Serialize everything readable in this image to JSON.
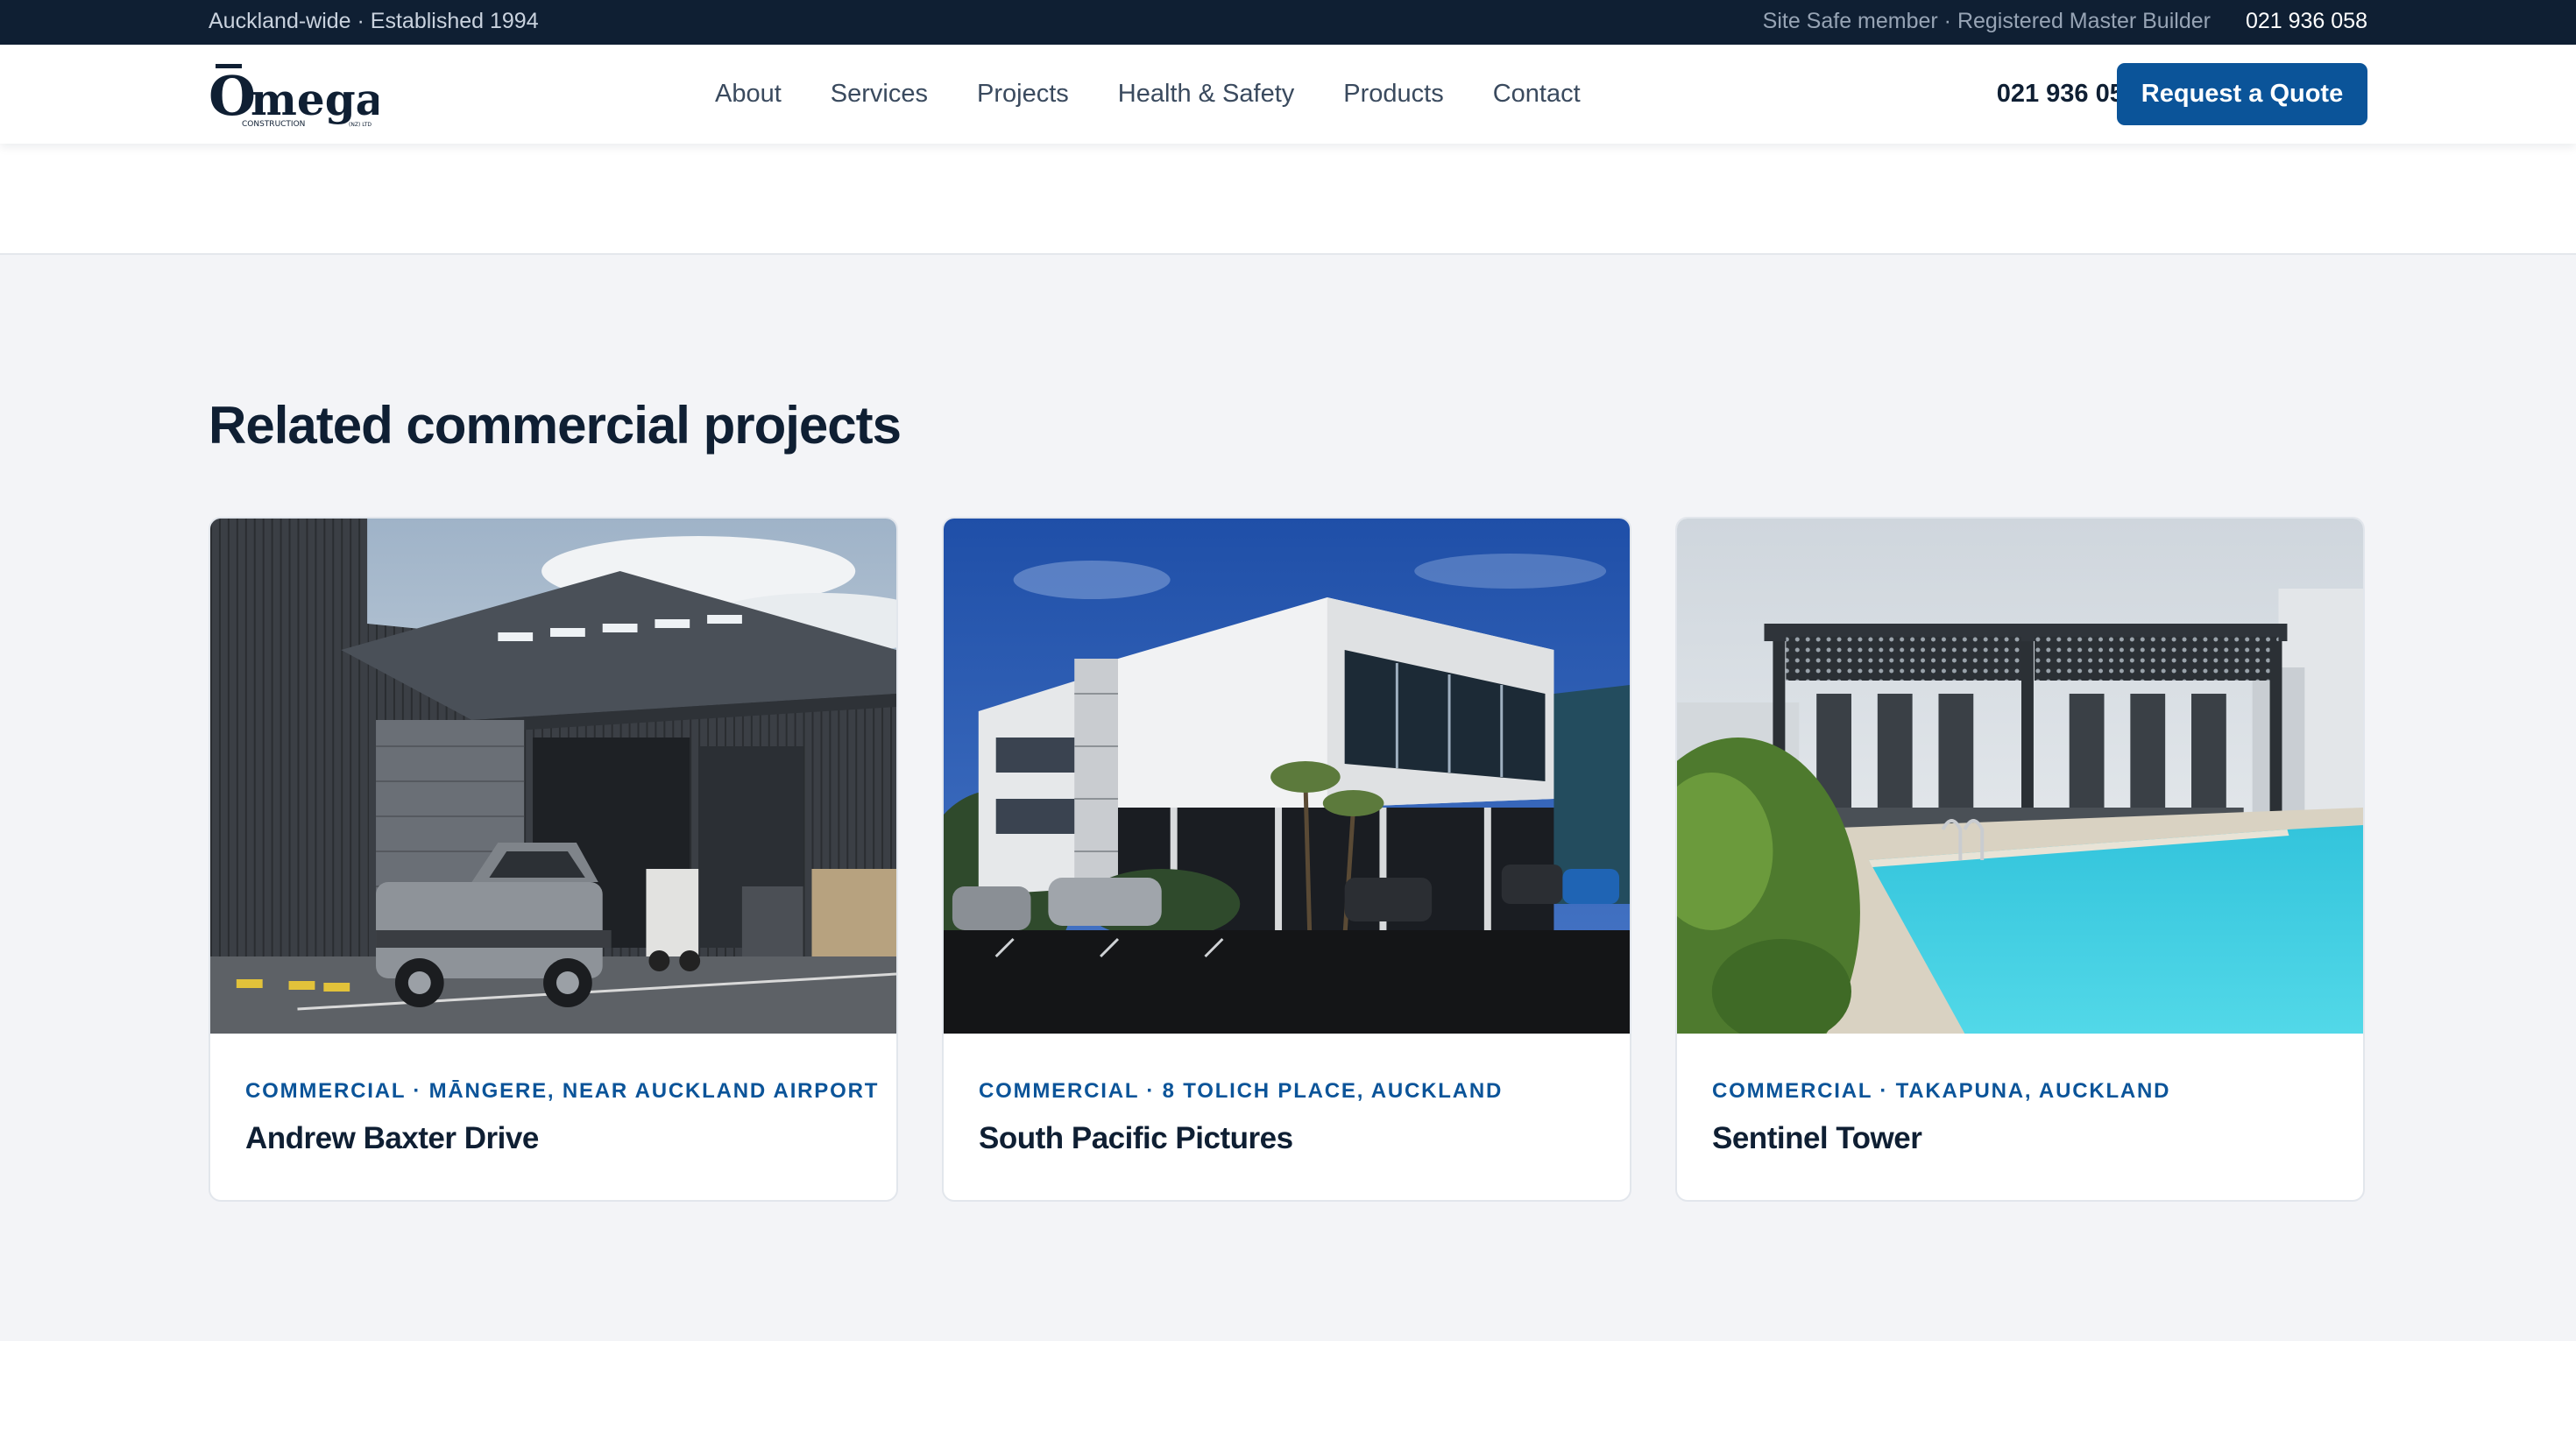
{
  "topbar": {
    "left_text": "Auckland-wide · Established 1994",
    "credentials": "Site Safe member · Registered Master Builder",
    "phone": "021 936 058"
  },
  "nav": {
    "logo_text": "mega",
    "logo_sub": "CONSTRUCTION",
    "logo_sub_small": "(NZ) LTD",
    "logo_letter": "O",
    "links": [
      "About",
      "Services",
      "Projects",
      "Health & Safety",
      "Products",
      "Contact"
    ],
    "phone": "021 936 058",
    "quote_label": "Request a Quote"
  },
  "related": {
    "title": "Related commercial projects",
    "projects": [
      {
        "meta": "COMMERCIAL · MĀNGERE, NEAR AUCKLAND AIRPORT",
        "name": "Andrew Baxter Drive",
        "image": "warehouse-photo"
      },
      {
        "meta": "COMMERCIAL · 8 TOLICH PLACE, AUCKLAND",
        "name": "South Pacific Pictures",
        "image": "office-building-photo"
      },
      {
        "meta": "COMMERCIAL · TAKAPUNA, AUCKLAND",
        "name": "Sentinel Tower",
        "image": "pool-pergola-photo"
      }
    ]
  },
  "colors": {
    "topbar_bg": "#0f1f33",
    "accent": "#0b5499",
    "section_bg": "#f3f4f7",
    "heading": "#0f1f33"
  }
}
